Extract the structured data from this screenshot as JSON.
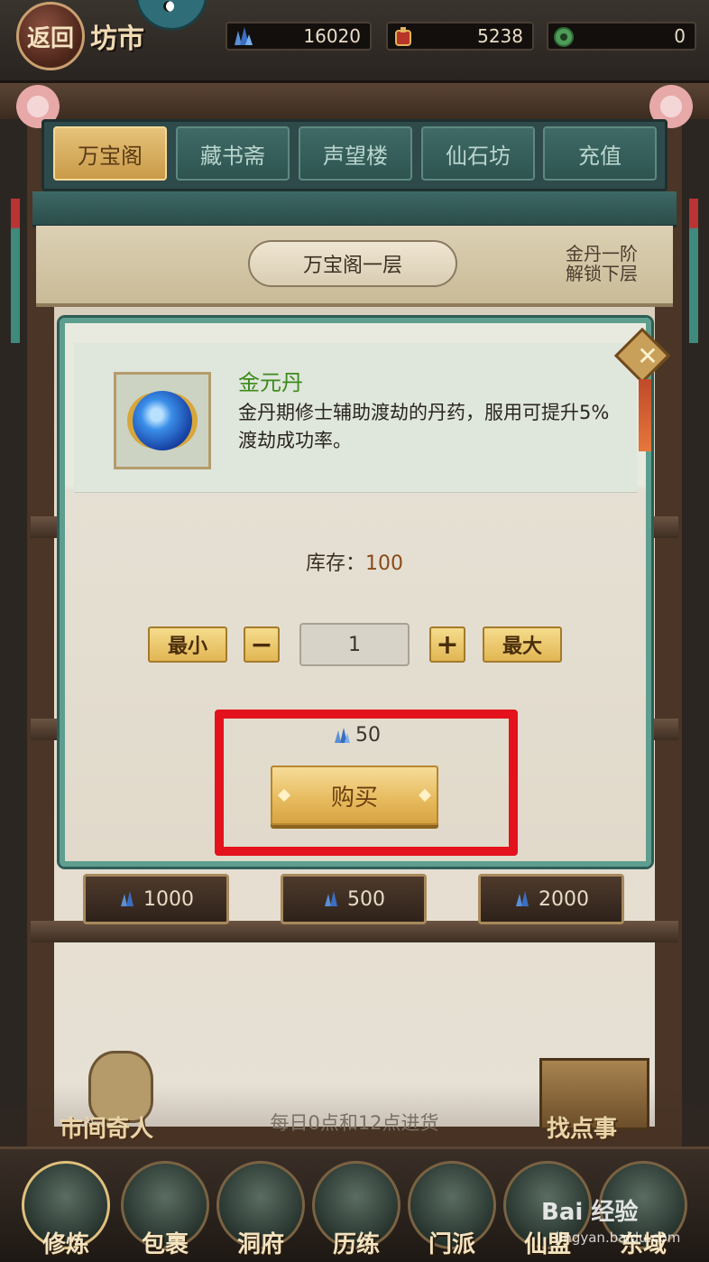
{
  "header": {
    "back_label": "返回",
    "title": "坊市",
    "currencies": [
      {
        "icon": "spirit-crystal-icon",
        "value": "16020"
      },
      {
        "icon": "red-pouch-icon",
        "value": "5238"
      },
      {
        "icon": "jade-coin-icon",
        "value": "0"
      }
    ]
  },
  "tabs": [
    {
      "label": "万宝阁",
      "active": true
    },
    {
      "label": "藏书斋",
      "active": false
    },
    {
      "label": "声望楼",
      "active": false
    },
    {
      "label": "仙石坊",
      "active": false
    },
    {
      "label": "充值",
      "active": false
    }
  ],
  "floor": {
    "label": "万宝阁一层",
    "unlock_hint_line1": "金丹一阶",
    "unlock_hint_line2": "解锁下层"
  },
  "shelf_prices": [
    "1000",
    "500",
    "2000"
  ],
  "dialog": {
    "item_name": "金元丹",
    "item_desc": "金丹期修士辅助渡劫的丹药，服用可提升5%渡劫成功率。",
    "stock_label": "库存：",
    "stock_value": "100",
    "min_label": "最小",
    "minus_label": "−",
    "quantity": "1",
    "plus_label": "+",
    "max_label": "最大",
    "cost": "50",
    "buy_label": "购买",
    "close_icon": "✕"
  },
  "restock_note": "每日0点和12点进货",
  "npcs": {
    "left_label": "市间奇人",
    "right_label": "找点事"
  },
  "nav": [
    {
      "label": "修炼",
      "active": true
    },
    {
      "label": "包裹",
      "active": false
    },
    {
      "label": "洞府",
      "active": false
    },
    {
      "label": "历练",
      "active": false
    },
    {
      "label": "门派",
      "active": false
    },
    {
      "label": "仙盟",
      "active": false
    },
    {
      "label": "东域",
      "active": false
    }
  ],
  "watermark": {
    "brand": "Bai 经验",
    "url": "jingyan.baidu.com"
  },
  "colors": {
    "highlight": "#e3121c",
    "accent_gold": "#e6b95c",
    "frame_teal": "#5e9e8f"
  }
}
